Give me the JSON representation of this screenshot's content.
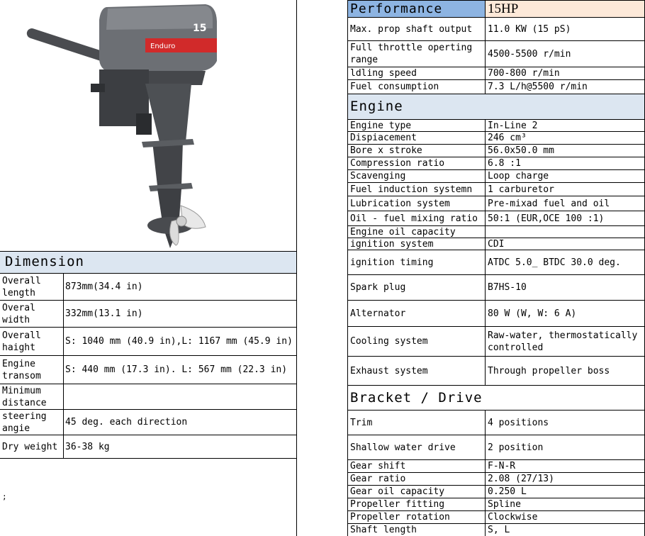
{
  "performance": {
    "title": "Performance",
    "model": "15HP",
    "rows": [
      {
        "label": "Max. prop shaft output",
        "value": "11.0 KW (15 pS)"
      },
      {
        "label": "Full throttle operting range",
        "value": "4500-5500 r/min"
      },
      {
        "label": "ldling speed",
        "value": "700-800 r/min"
      },
      {
        "label": "Fuel consumption",
        "value": "7.3 L/h@5500 r/min"
      }
    ]
  },
  "engine": {
    "title": "Engine",
    "rows": [
      {
        "label": "Engine type",
        "value": "In-Line 2"
      },
      {
        "label": "Dispiacement",
        "value": "246 cm³"
      },
      {
        "label": "Bore x stroke",
        "value": "56.0x50.0 mm"
      },
      {
        "label": "Compression ratio",
        "value": "6.8 :1"
      },
      {
        "label": "Scavenging",
        "value": "Loop charge"
      },
      {
        "label": "Fuel induction systemn",
        "value": "1 carburetor"
      },
      {
        "label": "Lubrication system",
        "value": "Pre-mixad fuel and oil"
      },
      {
        "label": "Oil - fuel mixing ratio",
        "value": "50:1 (EUR,OCE 100 :1)"
      },
      {
        "label": "Engine oil capacity",
        "value": ""
      },
      {
        "label": "ignition system",
        "value": "CDI"
      },
      {
        "label": "ignition timing",
        "value": "ATDC 5.0_ BTDC 30.0 deg."
      },
      {
        "label": "Spark plug",
        "value": "B7HS-10"
      },
      {
        "label": "Alternator",
        "value": "80 W (W, W: 6 A)"
      },
      {
        "label": "Cooling system",
        "value": "Raw-water, thermostatically controlled"
      },
      {
        "label": "Exhaust system",
        "value": "Through propeller boss"
      }
    ]
  },
  "bracket": {
    "title": "Bracket / Drive",
    "rows": [
      {
        "label": "Trim",
        "value": "4 positions"
      },
      {
        "label": "Shallow water drive",
        "value": "2 position"
      },
      {
        "label": "Gear shift",
        "value": "F-N-R"
      },
      {
        "label": "Gear ratio",
        "value": "2.08 (27/13)"
      },
      {
        "label": "Gear oil capacity",
        "value": "0.250 L"
      },
      {
        "label": "Propeller fitting",
        "value": "Spline"
      },
      {
        "label": "Propeller rotation",
        "value": "Clockwise"
      },
      {
        "label": "Shaft length",
        "value": "S, L"
      }
    ]
  },
  "dimension": {
    "title": "Dimension",
    "rows": [
      {
        "label": "Overall length",
        "value": "873mm(34.4 in)"
      },
      {
        "label": "Overal width",
        "value": "332mm(13.1 in)"
      },
      {
        "label": "Overall haight",
        "value": "S: 1040 mm (40.9 in),L: 1167 mm (45.9 in)"
      },
      {
        "label": "Engine transom",
        "value": "S: 440 mm (17.3 in). L: 567 mm (22.3 in)"
      },
      {
        "label": "Minimum distance",
        "value": ""
      },
      {
        "label": "steering angie",
        "value": "45 deg. each direction"
      },
      {
        "label": "Dry weight",
        "value": "36-38 kg"
      }
    ]
  },
  "engine_image": {
    "brand_text": "Enduro",
    "badge": "15",
    "body_color": "#5e6165",
    "stripe_color": "#d12a2a"
  },
  "footnote": ";"
}
